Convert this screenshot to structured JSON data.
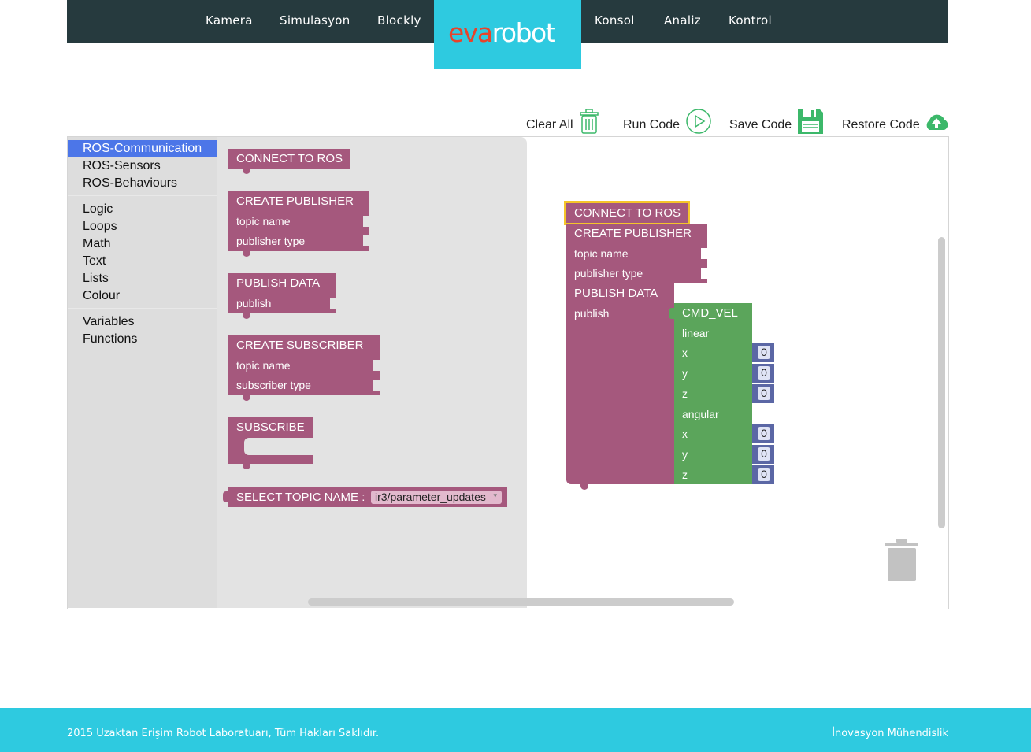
{
  "nav": {
    "left_links": [
      "Kamera",
      "Simulasyon",
      "Blockly"
    ],
    "right_links": [
      "Konsol",
      "Analiz",
      "Kontrol"
    ],
    "logo": {
      "eva": "eva",
      "robot": "robot"
    }
  },
  "toolbar": {
    "clear_all": "Clear All",
    "run_code": "Run Code",
    "save_code": "Save Code",
    "restore_code": "Restore Code"
  },
  "toolbox": {
    "group1": [
      "ROS-Communication",
      "ROS-Sensors",
      "ROS-Behaviours"
    ],
    "group2": [
      "Logic",
      "Loops",
      "Math",
      "Text",
      "Lists",
      "Colour"
    ],
    "group3": [
      "Variables",
      "Functions"
    ],
    "selected": "ROS-Communication"
  },
  "flyout": {
    "connect": "CONNECT TO ROS",
    "create_publisher": "CREATE PUBLISHER",
    "topic_name": "topic name",
    "publisher_type": "publisher type",
    "publish_data": "PUBLISH DATA",
    "publish": "publish",
    "create_subscriber": "CREATE SUBSCRIBER",
    "subscriber_type": "subscriber type",
    "subscribe": "SUBSCRIBE",
    "select_topic": "SELECT TOPIC NAME :",
    "topic_value": "ir3/parameter_updates"
  },
  "canvas": {
    "connect": "CONNECT TO ROS",
    "create_publisher": "CREATE PUBLISHER",
    "topic_name": "topic name",
    "publisher_type": "publisher type",
    "publish_data": "PUBLISH DATA",
    "publish": "publish",
    "cmd_vel": "CMD_VEL",
    "linear": "linear",
    "angular": "angular",
    "x": "x",
    "y": "y",
    "z": "z",
    "lin_x": "0",
    "lin_y": "0",
    "lin_z": "0",
    "ang_x": "0",
    "ang_y": "0",
    "ang_z": "0"
  },
  "colors": {
    "topbar": "#263a3e",
    "accent": "#2ecae0",
    "ros_block": "#a5587d",
    "math_block": "#5b67a5",
    "green_block": "#5ba55b",
    "toolbox_selected": "#4c76e8"
  },
  "footer": {
    "left": "2015 Uzaktan Erişim Robot Laboratuarı, Tüm Hakları Saklıdır.",
    "right": "İnovasyon Mühendislik"
  }
}
